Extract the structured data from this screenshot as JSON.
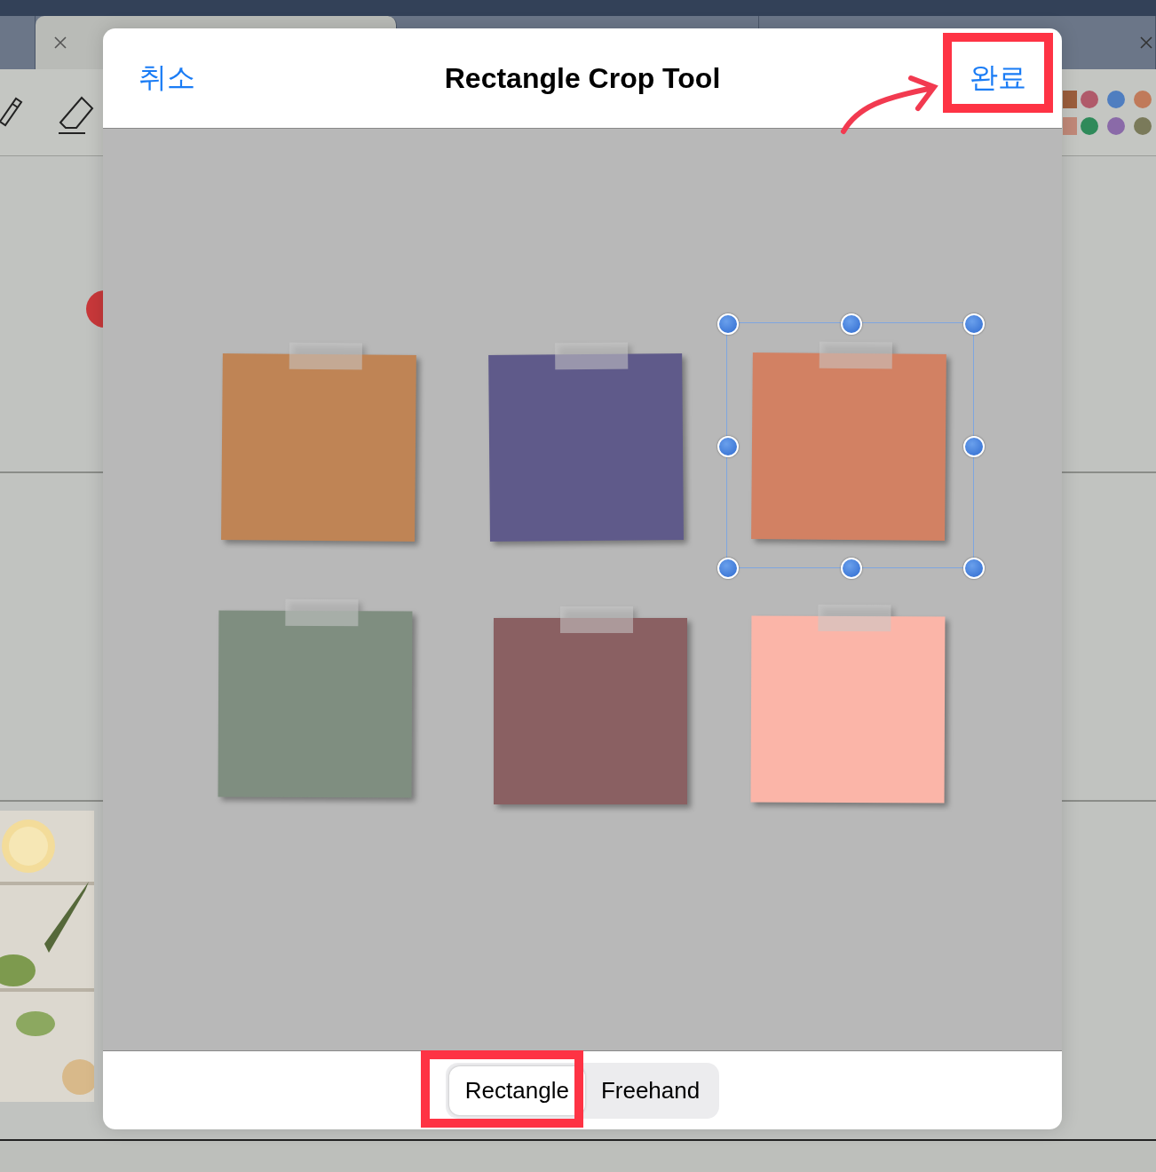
{
  "dialog": {
    "title": "Rectangle Crop Tool",
    "cancel_button": "취소",
    "done_button": "완료"
  },
  "notes": [
    {
      "color": "#bf8455",
      "selected": false
    },
    {
      "color": "#5f5a8a",
      "selected": false
    },
    {
      "color": "#d28163",
      "selected": true
    },
    {
      "color": "#7f8e80",
      "selected": false
    },
    {
      "color": "#8a6062",
      "selected": false
    },
    {
      "color": "#fbb5a8",
      "selected": false
    }
  ],
  "modes": [
    {
      "label": "Rectangle",
      "selected": true
    },
    {
      "label": "Freehand",
      "selected": false
    }
  ]
}
